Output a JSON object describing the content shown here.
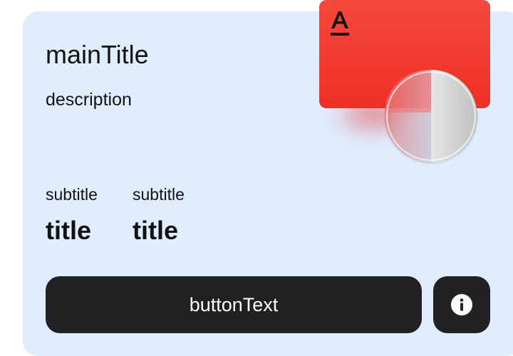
{
  "card": {
    "main_title": "mainTitle",
    "description": "description",
    "stats": [
      {
        "subtitle": "subtitle",
        "title": "title"
      },
      {
        "subtitle": "subtitle",
        "title": "title"
      }
    ],
    "button_text": "buttonText",
    "info_icon": "info-icon"
  },
  "illustration": {
    "bank_logo": "A",
    "colors": {
      "card_background": "#dfedfe",
      "bank_card_red": "#f03a2f",
      "button_dark": "#212124",
      "coin_silver": "#d0d0d0"
    }
  }
}
